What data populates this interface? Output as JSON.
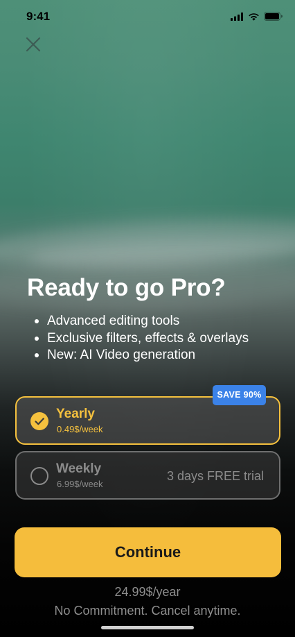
{
  "status_bar": {
    "time": "9:41",
    "icons": [
      "signal-icon",
      "wifi-icon",
      "battery-icon"
    ]
  },
  "header": {
    "close_icon": "close-icon"
  },
  "hero": {
    "title": "Ready to go Pro?",
    "features": [
      "Advanced editing tools",
      "Exclusive filters, effects & overlays",
      "New: AI Video generation"
    ]
  },
  "plans": {
    "yearly": {
      "name": "Yearly",
      "price": "0.49$/week",
      "badge": "SAVE 90%",
      "selected": true
    },
    "weekly": {
      "name": "Weekly",
      "price": "6.99$/week",
      "trial": "3 days FREE trial",
      "selected": false
    }
  },
  "cta": {
    "continue_label": "Continue"
  },
  "footer": {
    "price_note": "24.99$/year",
    "commitment_note": "No Commitment. Cancel anytime."
  },
  "colors": {
    "accent": "#f5bd3c",
    "badge": "#3b82e8",
    "muted": "#8e8e8e"
  }
}
